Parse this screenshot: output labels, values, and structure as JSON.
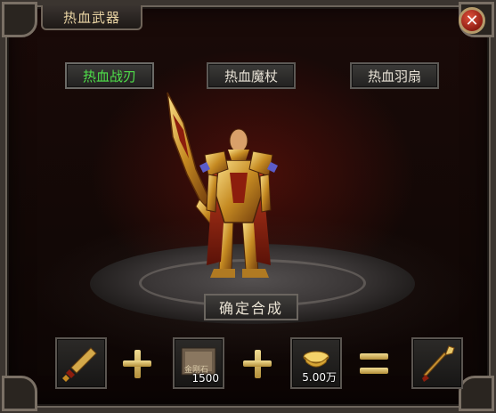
{
  "window": {
    "title": "热血武器",
    "close_glyph": "✕"
  },
  "tabs": [
    {
      "label": "热血战刃",
      "active": true
    },
    {
      "label": "热血魔杖",
      "active": false
    },
    {
      "label": "热血羽扇",
      "active": false
    }
  ],
  "confirm_button": {
    "label": "确定合成"
  },
  "recipe": {
    "slots": [
      {
        "icon": "sword-item-icon",
        "qty": ""
      },
      {
        "icon": "material-box-icon",
        "mini_label": "金刚石",
        "qty": "1500"
      },
      {
        "icon": "gold-ingot-icon",
        "qty": "5.00万"
      },
      {
        "icon": "spear-result-icon",
        "qty": ""
      }
    ],
    "operators": [
      "plus",
      "plus",
      "equals"
    ]
  },
  "colors": {
    "active_tab_text": "#4fe04a",
    "gold": "#e8c86a",
    "frame": "#6d655c"
  }
}
